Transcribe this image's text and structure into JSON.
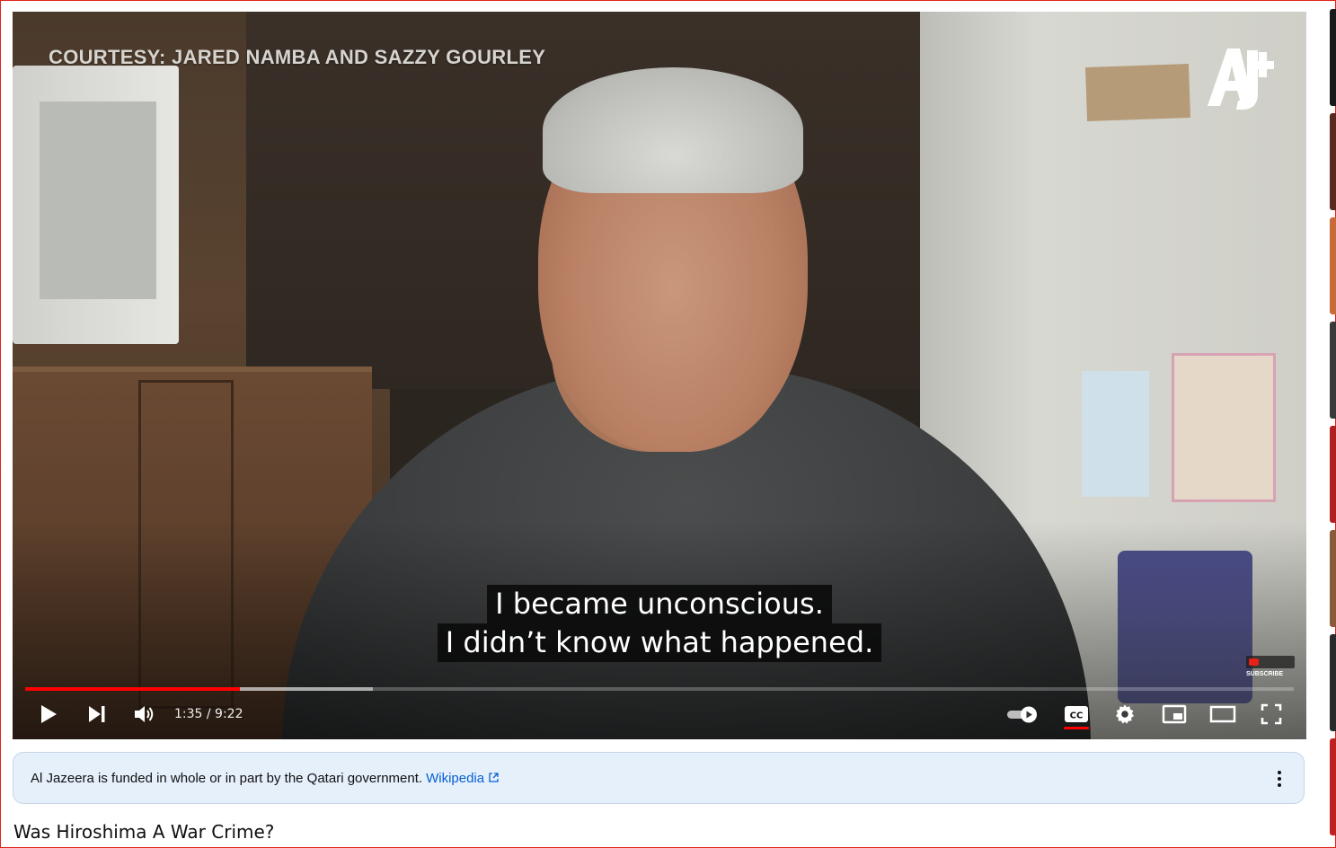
{
  "video": {
    "overlay_text": "COURTESY: JARED NAMBA AND SAZZY GOURLEY",
    "logo_text": "AJ+",
    "captions": [
      "I became unconscious.",
      "I didn’t know what happened."
    ],
    "subscribe_badge": "SUBSCRIBE",
    "progress": {
      "played_fraction": 0.169,
      "buffered_fraction": 0.274
    },
    "time_current": "1:35",
    "time_total": "9:22",
    "time_display": "1:35 / 9:22"
  },
  "controls": {
    "icons": [
      "play-icon",
      "next-icon",
      "volume-icon",
      "autoplay-toggle-icon",
      "captions-icon",
      "settings-icon",
      "miniplayer-icon",
      "theater-mode-icon",
      "fullscreen-icon"
    ],
    "cc_label": "CC",
    "accent_color": "#ff0000"
  },
  "banner": {
    "text": "Al Jazeera is funded in whole or in part by the Qatari government.",
    "link_text": "Wikipedia",
    "background": "#e6f0fb",
    "link_color": "#065fd4"
  },
  "title": "Was Hiroshima A War Crime?"
}
